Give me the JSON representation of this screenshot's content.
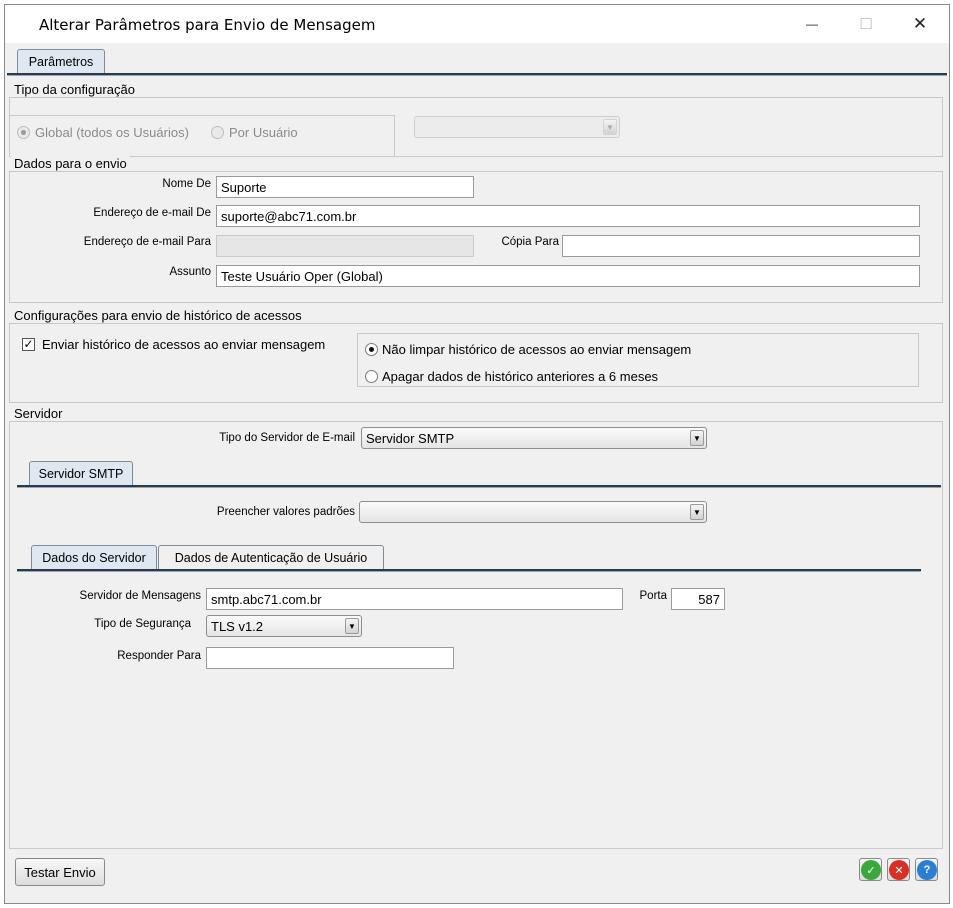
{
  "window": {
    "title": "Alterar Parâmetros para Envio de Mensagem",
    "minimize_glyph": "—",
    "maximize_glyph": "☐",
    "close_glyph": "✕"
  },
  "main_tab": {
    "label": "Parâmetros"
  },
  "config_type": {
    "legend": "Tipo da configuração",
    "options": [
      {
        "label": "Global (todos os Usuários)",
        "selected": true,
        "enabled": false
      },
      {
        "label": "Por Usuário",
        "selected": false,
        "enabled": false
      }
    ],
    "user_select_value": ""
  },
  "send_data": {
    "legend": "Dados para o envio",
    "from_name_label": "Nome De",
    "from_name_value": "Suporte",
    "from_email_label": "Endereço de e-mail De",
    "from_email_value": "suporte@abc71.com.br",
    "to_email_label": "Endereço de e-mail Para",
    "to_email_value": "",
    "cc_label": "Cópia Para",
    "cc_value": "",
    "subject_label": "Assunto",
    "subject_value": "Teste Usuário Oper (Global)"
  },
  "history": {
    "legend": "Configurações para envio de histórico de acessos",
    "send_checkbox_label": "Enviar histórico de acessos ao enviar mensagem",
    "send_checked": true,
    "options": [
      {
        "label": "Não limpar histórico de acessos ao enviar mensagem",
        "selected": true
      },
      {
        "label": "Apagar dados de histórico anteriores a 6 meses",
        "selected": false
      }
    ]
  },
  "server": {
    "legend": "Servidor",
    "type_label": "Tipo do Servidor de E-mail",
    "type_value": "Servidor SMTP",
    "smtp_tab": "Servidor SMTP",
    "defaults_label": "Preencher valores padrões",
    "defaults_value": "",
    "subtabs": [
      "Dados do Servidor",
      "Dados de Autenticação de Usuário"
    ],
    "host_label": "Servidor de Mensagens",
    "host_value": "smtp.abc71.com.br",
    "port_label": "Porta",
    "port_value": "587",
    "security_label": "Tipo de Segurança",
    "security_value": "TLS v1.2",
    "reply_label": "Responder Para",
    "reply_value": ""
  },
  "footer": {
    "test_button": "Testar Envio",
    "icons": [
      {
        "name": "confirm-icon",
        "glyph": "✓",
        "color": "#3aa83a"
      },
      {
        "name": "cancel-icon",
        "glyph": "✕",
        "color": "#d93025"
      },
      {
        "name": "help-icon",
        "glyph": "?",
        "color": "#2a7fd4"
      }
    ]
  }
}
